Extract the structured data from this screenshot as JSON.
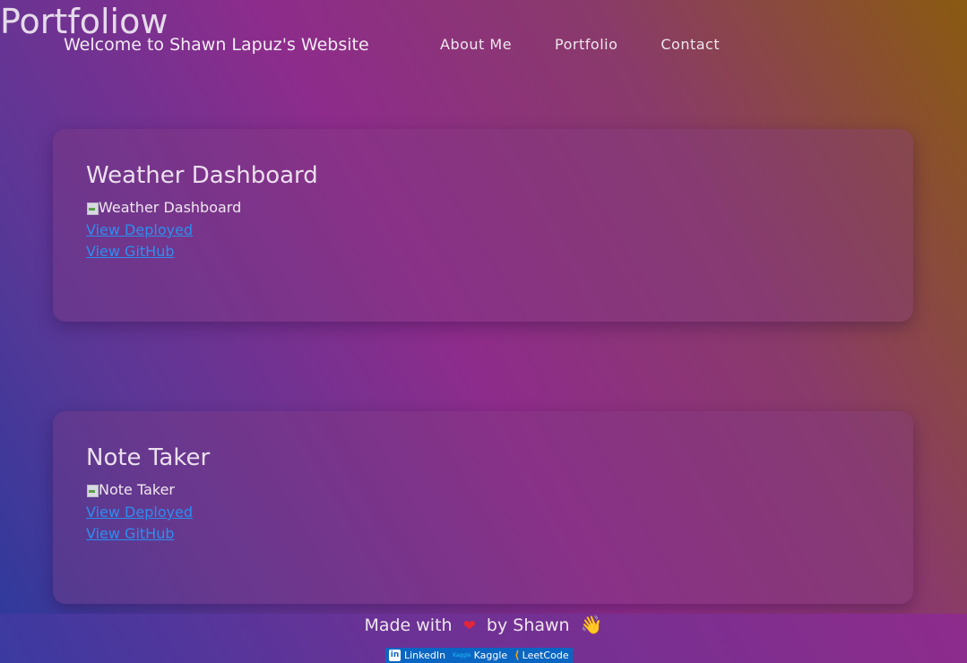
{
  "header": {
    "brand": "Portfoliow",
    "welcome": "Welcome to Shawn Lapuz's Website",
    "nav": [
      {
        "label": "About Me"
      },
      {
        "label": "Portfolio"
      },
      {
        "label": "Contact"
      }
    ]
  },
  "projects": [
    {
      "title": "Weather Dashboard",
      "image_alt": "Weather Dashboard",
      "deployed_label": "View Deployed",
      "github_label": "View GitHub"
    },
    {
      "title": "Note Taker",
      "image_alt": "Note Taker",
      "deployed_label": "View Deployed",
      "github_label": "View GitHub"
    }
  ],
  "footer": {
    "made_with_prefix": "Made with",
    "made_with_suffix": "by Shawn",
    "heart_icon": "heart-icon",
    "wave_icon": "waving-hand-icon",
    "social": [
      {
        "label": "LinkedIn",
        "icon": "linkedin-icon",
        "icon_text": "in"
      },
      {
        "label": "Kaggle",
        "icon": "kaggle-icon",
        "icon_text": "Kaggle"
      },
      {
        "label": "LeetCode",
        "icon": "leetcode-icon",
        "icon_text": "⟨"
      }
    ]
  },
  "colors": {
    "link": "#2d8ef0",
    "social_bar": "#0a66c2",
    "heart": "#e3263a"
  }
}
